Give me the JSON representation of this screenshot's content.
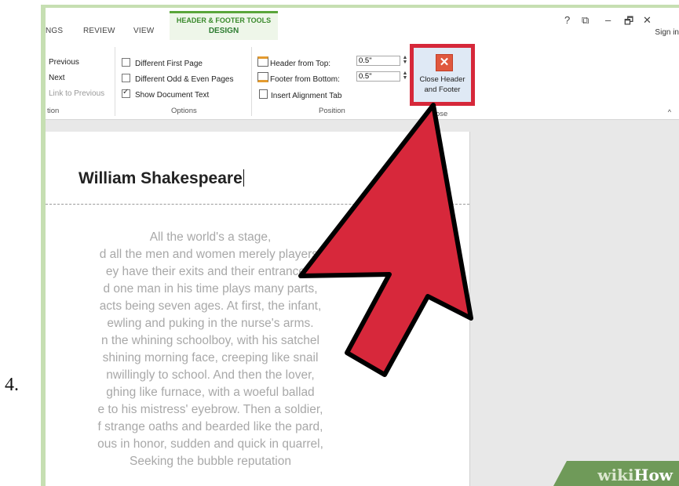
{
  "step_number": "4.",
  "ribbon": {
    "tabs": [
      "NGS",
      "REVIEW",
      "VIEW"
    ],
    "context_group": "HEADER & FOOTER TOOLS",
    "active_tab": "DESIGN",
    "window_controls": [
      "?",
      "⧉",
      "–",
      "🗗",
      "✕"
    ],
    "sign_in": "Sign in",
    "navigation": {
      "items": [
        "Previous",
        "Next",
        "Link to Previous"
      ],
      "label": "tion"
    },
    "options": {
      "items": [
        {
          "label": "Different First Page",
          "checked": false
        },
        {
          "label": "Different Odd & Even Pages",
          "checked": false
        },
        {
          "label": "Show Document Text",
          "checked": true
        }
      ],
      "label": "Options"
    },
    "position": {
      "header_from_top_label": "Header from Top:",
      "header_from_top_value": "0.5\"",
      "footer_from_bottom_label": "Footer from Bottom:",
      "footer_from_bottom_value": "0.5\"",
      "insert_alignment_tab": "Insert Alignment Tab",
      "label": "Position"
    },
    "close": {
      "button_label": "Close Header\nand Footer",
      "group_label": "ose"
    },
    "collapse_icon": "^"
  },
  "document": {
    "header_text": "William Shakespeare",
    "lines": [
      "All the world's a stage,",
      "d all the men and women merely players;",
      "ey have their exits and their entrances,",
      "d one man in his time plays many parts,",
      "acts being seven ages. At first, the infant,",
      "ewling and puking in the nurse's arms.",
      "n the whining schoolboy, with his satchel",
      "shining morning face, creeping like snail",
      "nwillingly to school. And then the lover,",
      "ghing like furnace, with a woeful ballad",
      "e to his mistress' eyebrow. Then a soldier,",
      "f strange oaths and bearded like the pard,",
      "ous in honor, sudden and quick in quarrel,",
      "Seeking the bubble reputation"
    ]
  },
  "watermark": {
    "wiki": "wiki",
    "how": "How"
  },
  "colors": {
    "highlight": "#d6283a",
    "arrow": "#d7283b",
    "accent": "#5aa53a"
  }
}
